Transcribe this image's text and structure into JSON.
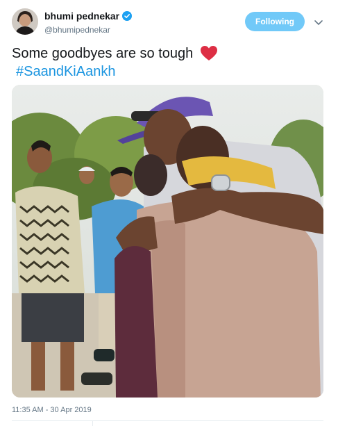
{
  "author": {
    "display_name": "bhumi pednekar",
    "handle": "@bhumipednekar",
    "verified": true
  },
  "follow_button": {
    "label": "Following"
  },
  "more_icon": "chevron-down-icon",
  "tweet": {
    "text": "Some goodbyes are so tough",
    "emoji": "red-heart",
    "hashtag": "#SaandKiAankh",
    "timestamp": "11:35 AM - 30 Apr 2019"
  },
  "colors": {
    "brand_blue": "#1b95e0",
    "follow_button_bg": "#71c9f8",
    "secondary_text": "#657786",
    "heart_red": "#e0245e"
  }
}
